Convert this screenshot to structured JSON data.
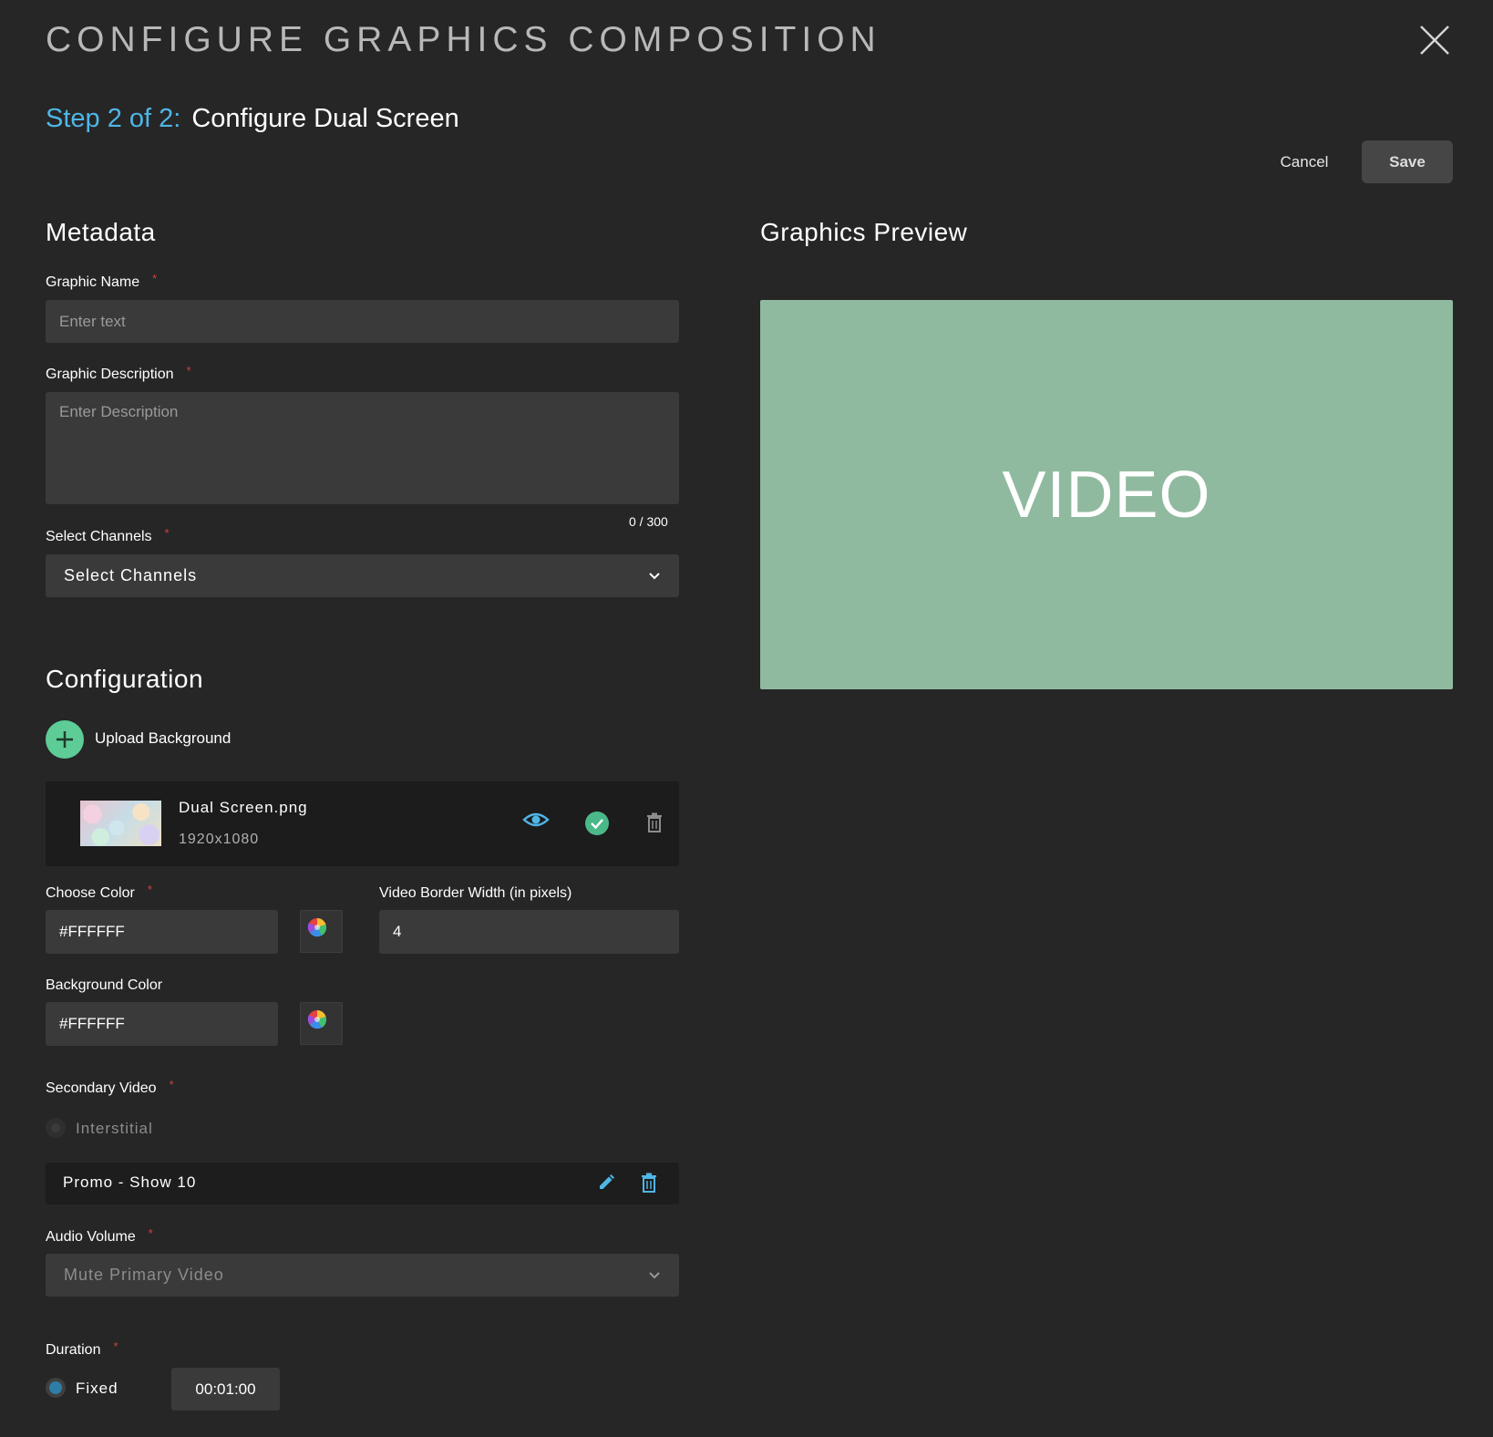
{
  "header": {
    "title": "CONFIGURE GRAPHICS COMPOSITION",
    "step_prefix": "Step 2 of 2:",
    "step_title": "Configure Dual Screen",
    "cancel_label": "Cancel",
    "save_label": "Save"
  },
  "metadata": {
    "heading": "Metadata",
    "graphic_name": {
      "label": "Graphic Name",
      "placeholder": "Enter text",
      "value": ""
    },
    "graphic_description": {
      "label": "Graphic Description",
      "placeholder": "Enter Description",
      "value": "",
      "counter": "0 / 300"
    },
    "channels": {
      "label": "Select Channels",
      "value": "Select Channels"
    }
  },
  "configuration": {
    "heading": "Configuration",
    "upload_label": "Upload Background",
    "background_file": {
      "name": "Dual Screen.png",
      "dimensions": "1920x1080"
    },
    "choose_color": {
      "label": "Choose Color",
      "value": "#FFFFFF"
    },
    "border_width": {
      "label": "Video Border Width (in pixels)",
      "value": "4"
    },
    "background_color": {
      "label": "Background Color",
      "value": "#FFFFFF"
    },
    "secondary_video": {
      "label": "Secondary Video",
      "option": "Interstitial",
      "item": "Promo - Show 10"
    },
    "audio_volume": {
      "label": "Audio Volume",
      "value": "Mute Primary Video"
    },
    "duration": {
      "label": "Duration",
      "option": "Fixed",
      "value": "00:01:00"
    }
  },
  "preview": {
    "heading": "Graphics Preview",
    "text": "VIDEO",
    "background": "#90ba9f"
  },
  "colors": {
    "accent_blue": "#4fb6e6",
    "accent_green": "#5dcc96",
    "required_star": "#d0433f"
  },
  "icons": [
    "close-icon",
    "chevron-down-icon",
    "plus-icon",
    "eye-icon",
    "check-circle-icon",
    "trash-icon",
    "color-wheel-icon",
    "pencil-icon"
  ]
}
